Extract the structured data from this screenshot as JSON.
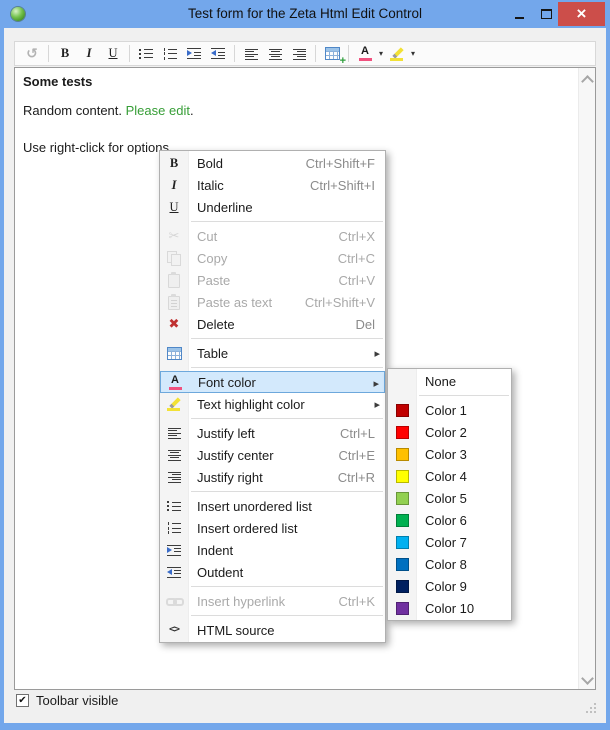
{
  "window": {
    "title": "Test form for the Zeta Html Edit Control"
  },
  "colors": {
    "titlebar": "#73a7eb",
    "close_button": "#cc4e4a",
    "menu_highlight_bg": "#d3e9fc",
    "menu_highlight_border": "#6da8dc",
    "link_green": "#379e37",
    "font_color_icon_bar": "#f0517e",
    "highlight_icon_bar": "#f2e136"
  },
  "toolbar": {
    "buttons": [
      {
        "icon": "undo-icon",
        "disabled": true
      },
      {
        "icon": "bold-icon"
      },
      {
        "icon": "italic-icon"
      },
      {
        "icon": "underline-icon"
      },
      {
        "icon": "unordered-list-icon"
      },
      {
        "icon": "ordered-list-icon"
      },
      {
        "icon": "indent-icon"
      },
      {
        "icon": "outdent-icon"
      },
      {
        "icon": "justify-left-icon"
      },
      {
        "icon": "justify-center-icon"
      },
      {
        "icon": "justify-right-icon"
      },
      {
        "icon": "insert-table-icon"
      },
      {
        "icon": "font-color-icon",
        "has_dropdown": true
      },
      {
        "icon": "highlight-color-icon",
        "has_dropdown": true
      }
    ]
  },
  "editor": {
    "heading": "Some tests",
    "para1_prefix": "Random content. ",
    "para1_link": "Please edit",
    "para1_suffix": ".",
    "para2": "Use right-click for options"
  },
  "context_menu": {
    "items": [
      {
        "label": "Bold",
        "shortcut": "Ctrl+Shift+F",
        "icon": "bold-icon"
      },
      {
        "label": "Italic",
        "shortcut": "Ctrl+Shift+I",
        "icon": "italic-icon"
      },
      {
        "label": "Underline",
        "shortcut": "",
        "icon": "underline-icon",
        "separator_after": true
      },
      {
        "label": "Cut",
        "shortcut": "Ctrl+X",
        "icon": "scissors-icon",
        "disabled": true
      },
      {
        "label": "Copy",
        "shortcut": "Ctrl+C",
        "icon": "copy-icon",
        "disabled": true
      },
      {
        "label": "Paste",
        "shortcut": "Ctrl+V",
        "icon": "paste-icon",
        "disabled": true
      },
      {
        "label": "Paste as text",
        "shortcut": "Ctrl+Shift+V",
        "icon": "paste-text-icon",
        "disabled": true
      },
      {
        "label": "Delete",
        "shortcut": "Del",
        "icon": "delete-icon",
        "separator_after": true
      },
      {
        "label": "Table",
        "shortcut": "",
        "icon": "table-icon",
        "has_submenu": true,
        "separator_after": true
      },
      {
        "label": "Font color",
        "shortcut": "",
        "icon": "font-color-icon",
        "has_submenu": true,
        "highlighted": true
      },
      {
        "label": "Text highlight color",
        "shortcut": "",
        "icon": "highlight-color-icon",
        "has_submenu": true,
        "separator_after": true
      },
      {
        "label": "Justify left",
        "shortcut": "Ctrl+L",
        "icon": "justify-left-icon"
      },
      {
        "label": "Justify center",
        "shortcut": "Ctrl+E",
        "icon": "justify-center-icon"
      },
      {
        "label": "Justify right",
        "shortcut": "Ctrl+R",
        "icon": "justify-right-icon",
        "separator_after": true
      },
      {
        "label": "Insert unordered list",
        "shortcut": "",
        "icon": "unordered-list-icon"
      },
      {
        "label": "Insert ordered list",
        "shortcut": "",
        "icon": "ordered-list-icon"
      },
      {
        "label": "Indent",
        "shortcut": "",
        "icon": "indent-icon"
      },
      {
        "label": "Outdent",
        "shortcut": "",
        "icon": "outdent-icon",
        "separator_after": true
      },
      {
        "label": "Insert hyperlink",
        "shortcut": "Ctrl+K",
        "icon": "hyperlink-icon",
        "disabled": true,
        "separator_after": true
      },
      {
        "label": "HTML source",
        "shortcut": "",
        "icon": "html-source-icon"
      }
    ]
  },
  "font_color_submenu": {
    "items": [
      {
        "label": "None",
        "color": null,
        "separator_after": true
      },
      {
        "label": "Color 1",
        "color": "#C00000"
      },
      {
        "label": "Color 2",
        "color": "#FF0000"
      },
      {
        "label": "Color 3",
        "color": "#FFC000"
      },
      {
        "label": "Color 4",
        "color": "#FFFF00"
      },
      {
        "label": "Color 5",
        "color": "#92D050"
      },
      {
        "label": "Color 6",
        "color": "#00B050"
      },
      {
        "label": "Color 7",
        "color": "#00B0F0"
      },
      {
        "label": "Color 8",
        "color": "#0070C0"
      },
      {
        "label": "Color 9",
        "color": "#002060"
      },
      {
        "label": "Color 10",
        "color": "#7030A0"
      }
    ]
  },
  "footer": {
    "toolbar_checkbox_label": "Toolbar visible",
    "checked": true
  }
}
